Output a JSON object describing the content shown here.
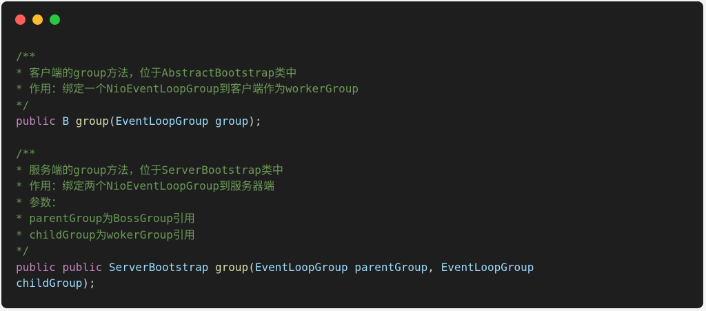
{
  "window": {
    "buttons": [
      {
        "name": "close",
        "color": "#ff5f57"
      },
      {
        "name": "minimize",
        "color": "#febc2e"
      },
      {
        "name": "zoom",
        "color": "#28c840"
      }
    ]
  },
  "colors": {
    "background": "#1e1e1e",
    "comment": "#6a9955",
    "keyword": "#c586c0",
    "type": "#9cdcfe",
    "function": "#dcdcaa",
    "text": "#d4d4d4"
  },
  "code_lines": [
    [
      {
        "t": "/**",
        "k": "comment"
      }
    ],
    [
      {
        "t": "* 客户端的group方法，位于AbstractBootstrap类中",
        "k": "comment"
      }
    ],
    [
      {
        "t": "* 作用：绑定一个NioEventLoopGroup到客户端作为workerGroup",
        "k": "comment"
      }
    ],
    [
      {
        "t": "*/",
        "k": "comment"
      }
    ],
    [
      {
        "t": "public",
        "k": "keyword"
      },
      {
        "t": " ",
        "k": "punct"
      },
      {
        "t": "B",
        "k": "type"
      },
      {
        "t": " ",
        "k": "punct"
      },
      {
        "t": "group",
        "k": "func"
      },
      {
        "t": "(",
        "k": "punct"
      },
      {
        "t": "EventLoopGroup",
        "k": "type"
      },
      {
        "t": " ",
        "k": "punct"
      },
      {
        "t": "group",
        "k": "param"
      },
      {
        "t": ");",
        "k": "punct"
      }
    ],
    [],
    [
      {
        "t": "/**",
        "k": "comment"
      }
    ],
    [
      {
        "t": "* 服务端的group方法，位于ServerBootstrap类中",
        "k": "comment"
      }
    ],
    [
      {
        "t": "* 作用：绑定两个NioEventLoopGroup到服务器端",
        "k": "comment"
      }
    ],
    [
      {
        "t": "* 参数：",
        "k": "comment"
      }
    ],
    [
      {
        "t": "* parentGroup为BossGroup引用",
        "k": "comment"
      }
    ],
    [
      {
        "t": "* childGroup为wokerGroup引用",
        "k": "comment"
      }
    ],
    [
      {
        "t": "*/",
        "k": "comment"
      }
    ],
    [
      {
        "t": "public",
        "k": "keyword"
      },
      {
        "t": " ",
        "k": "punct"
      },
      {
        "t": "public",
        "k": "keyword"
      },
      {
        "t": " ",
        "k": "punct"
      },
      {
        "t": "ServerBootstrap",
        "k": "type"
      },
      {
        "t": " ",
        "k": "punct"
      },
      {
        "t": "group",
        "k": "func"
      },
      {
        "t": "(",
        "k": "punct"
      },
      {
        "t": "EventLoopGroup",
        "k": "type"
      },
      {
        "t": " ",
        "k": "punct"
      },
      {
        "t": "parentGroup",
        "k": "param"
      },
      {
        "t": ", ",
        "k": "punct"
      },
      {
        "t": "EventLoopGroup",
        "k": "type"
      }
    ],
    [
      {
        "t": "childGroup",
        "k": "param"
      },
      {
        "t": ");",
        "k": "punct"
      }
    ]
  ]
}
